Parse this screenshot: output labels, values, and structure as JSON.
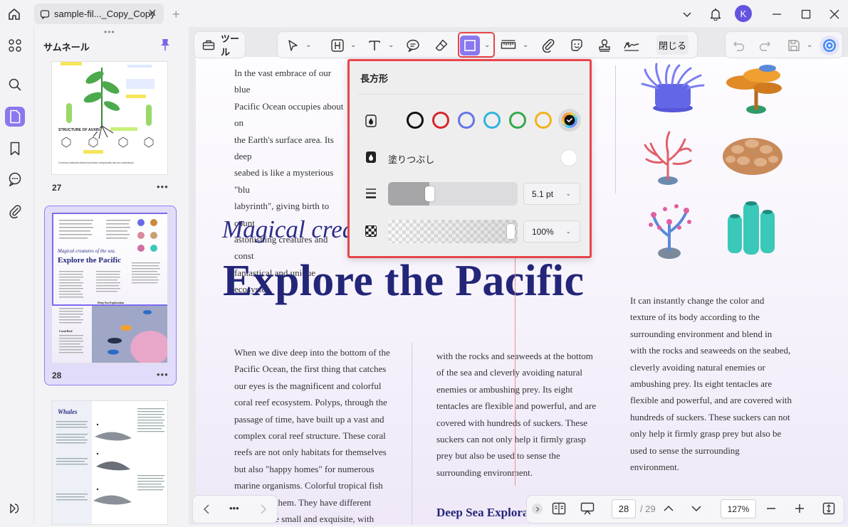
{
  "titlebar": {
    "tab_title": "sample-fil..._Copy_Copy",
    "tab_add": "+",
    "avatar_initial": "K"
  },
  "thumbnails": {
    "header": "サムネール",
    "grip": "•••",
    "pages": [
      {
        "number": "27",
        "menu": "•••"
      },
      {
        "number": "28",
        "menu": "•••"
      }
    ]
  },
  "thumb27": {
    "title": "STRUCTURE OF AUXIN",
    "caption": "Common features shared by these compounds can be understood"
  },
  "thumb28": {
    "magical": "Magical creatures of the sea.",
    "explore": "Explore the Pacific",
    "deep": "Deep Sea Exploration",
    "coral": "Coral Reef"
  },
  "thumb29": {
    "title": "Whales"
  },
  "toolbar": {
    "tool_label": "ツール",
    "close_label": "閉じる"
  },
  "popup": {
    "title": "長方形",
    "fill_label": "塗りつぶし",
    "stroke_width": "5.1 pt",
    "opacity": "100%",
    "stroke_width_fraction": 0.25,
    "opacity_fraction": 1.0,
    "colors": [
      "#111111",
      "#d6262b",
      "#6474e8",
      "#2fb3e0",
      "#35a84a",
      "#f2b21c"
    ],
    "fill_color": "#ffffff"
  },
  "document": {
    "para1": "In the vast embrace of our blue Pacific Ocean occupies about one-third of the Earth's surface area. Its deep seabed is like a mysterious \"blue labyrinth\", giving birth to countless astonishing creatures and constructing a fantastical and unique ecosystem.",
    "para1_lines": [
      "In the vast embrace of our blue",
      "Pacific Ocean occupies about on",
      "the Earth's surface area. Its deep",
      "seabed is like a mysterious \"blu",
      "labyrinth\", giving birth to count",
      "astonishing creatures and const",
      "fantastical and unique ecosyste"
    ],
    "magical": "Magical crea",
    "explore": "Explore the Pacific",
    "col1_lines": [
      "When we dive deep into the bottom of the",
      "Pacific Ocean, the first thing that catches",
      "our eyes is the magnificent and colorful",
      "coral reef ecosystem. Polyps, through the",
      "passage of time, have built up a vast and",
      "complex coral reef structure. These coral",
      "reefs are not only habitats for themselves",
      "but also \"happy homes\" for numerous",
      "marine organisms. Colorful tropical fish",
      "ing them. They have different",
      "e are small and exquisite, with"
    ],
    "col2_lines": [
      "with the rocks and seaweeds at the bottom",
      "of the sea and cleverly avoiding natural",
      "enemies or ambushing prey. Its eight",
      "tentacles are flexible and powerful, and are",
      "covered with hundreds of suckers. These",
      "suckers can not only help it firmly grasp",
      "prey but also be used to sense the",
      "surrounding environment."
    ],
    "col3_lines": [
      "It can instantly change the color and",
      "texture of its body according to the",
      "surrounding environment and blend in",
      "with the rocks and seaweeds on the seabed,",
      "cleverly avoiding natural enemies or",
      "ambushing prey. Its eight tentacles are",
      "flexible and powerful, and are covered with",
      "hundreds of suckers. These suckers can not",
      "only help it firmly grasp prey but also be",
      "used to sense the surrounding",
      "environment."
    ],
    "deep_heading": "Deep Sea Explora"
  },
  "navigation": {
    "more": "•••",
    "current_page": "28",
    "total_pages": "/ 29",
    "zoom": "127%"
  },
  "colors": {
    "accent": "#8a78ee",
    "highlight_red": "#e8454a",
    "heading_navy": "#232678"
  }
}
